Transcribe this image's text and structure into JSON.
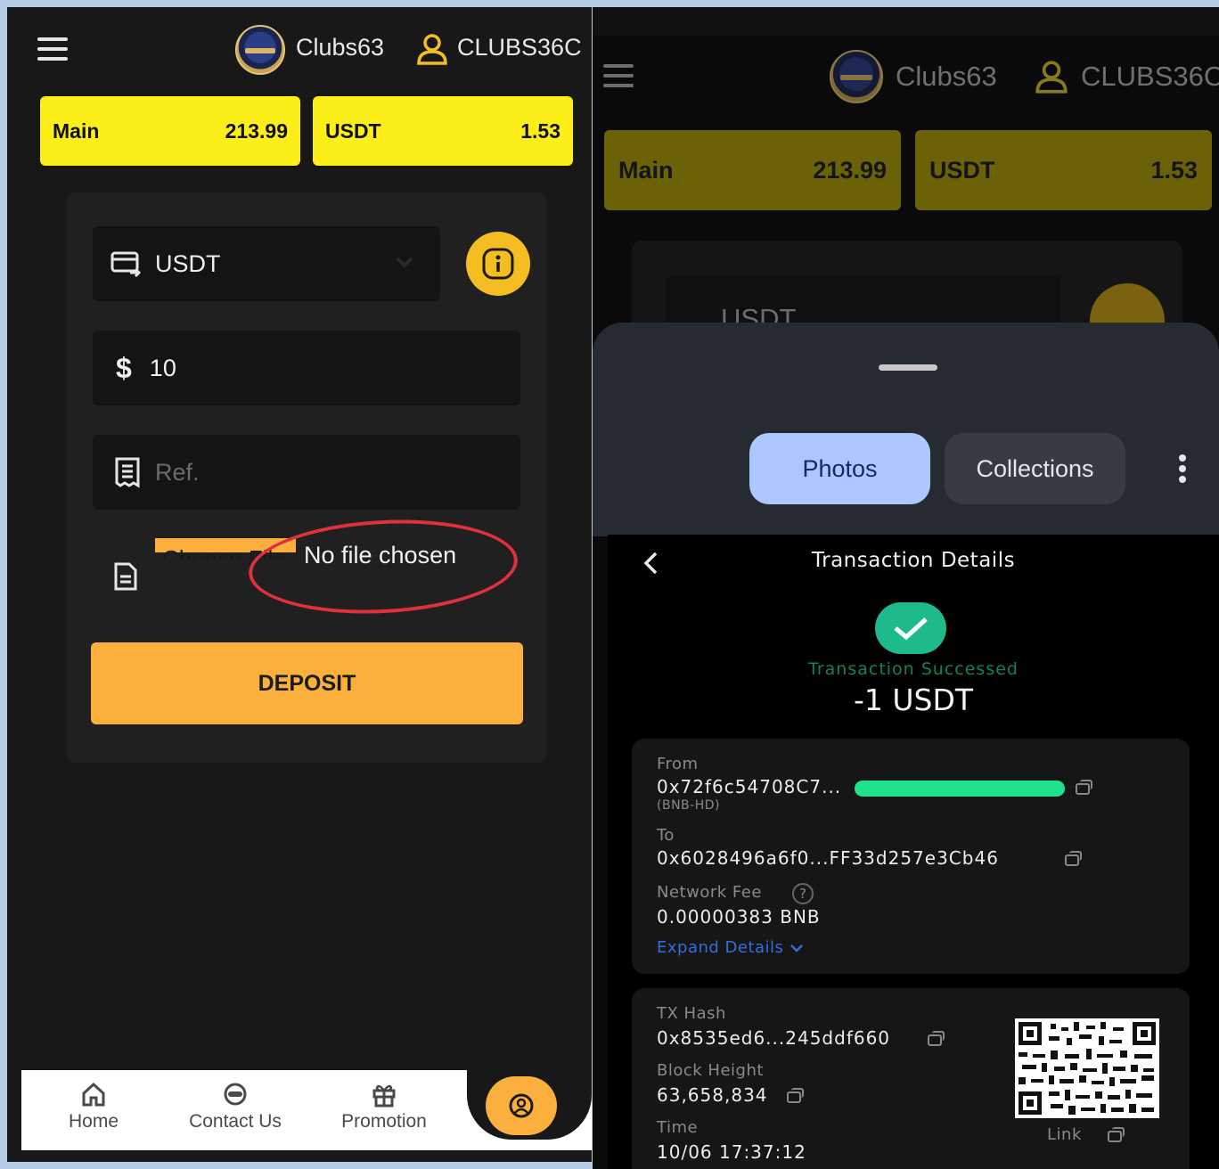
{
  "left": {
    "header": {
      "site_name": "Clubs63",
      "username": "CLUBS36C"
    },
    "balances": [
      {
        "label": "Main",
        "amount": "213.99"
      },
      {
        "label": "USDT",
        "amount": "1.53"
      }
    ],
    "form": {
      "currency": "USDT",
      "amount_symbol": "$",
      "amount_value": "10",
      "ref_placeholder": "Ref.",
      "file_button": "Choose File",
      "file_status": "No file chosen",
      "deposit_label": "DEPOSIT"
    },
    "nav": {
      "home": "Home",
      "contact": "Contact Us",
      "promotion": "Promotion"
    }
  },
  "right": {
    "header": {
      "site_name": "Clubs63",
      "username": "CLUBS36C"
    },
    "balances": [
      {
        "label": "Main",
        "amount": "213.99"
      },
      {
        "label": "USDT",
        "amount": "1.53"
      }
    ],
    "behind_currency": "USDT",
    "sheet": {
      "tab_photos": "Photos",
      "tab_collections": "Collections"
    },
    "transaction": {
      "title": "Transaction Details",
      "status": "Transaction Successed",
      "amount": "-1 USDT",
      "from_label": "From",
      "from_value": "0x72f6c54708C7...",
      "from_network": "(BNB-HD)",
      "to_label": "To",
      "to_value": "0x6028496a6f0...FF33d257e3Cb46",
      "fee_label": "Network Fee",
      "fee_value": "0.00000383 BNB",
      "expand_label": "Expand Details",
      "hash_label": "TX Hash",
      "hash_value": "0x8535ed6...245ddf660",
      "block_label": "Block Height",
      "block_value": "63,658,834",
      "time_label": "Time",
      "time_value": "10/06 17:37:12",
      "link_label": "Link"
    }
  },
  "colors": {
    "balance_yellow": "#fcef19",
    "deposit_orange": "#fbb03e",
    "success_green": "#1dba8c",
    "link_blue": "#2f6fdc",
    "highlight_red": "#e0303e",
    "redact_green": "#1fe38c"
  }
}
